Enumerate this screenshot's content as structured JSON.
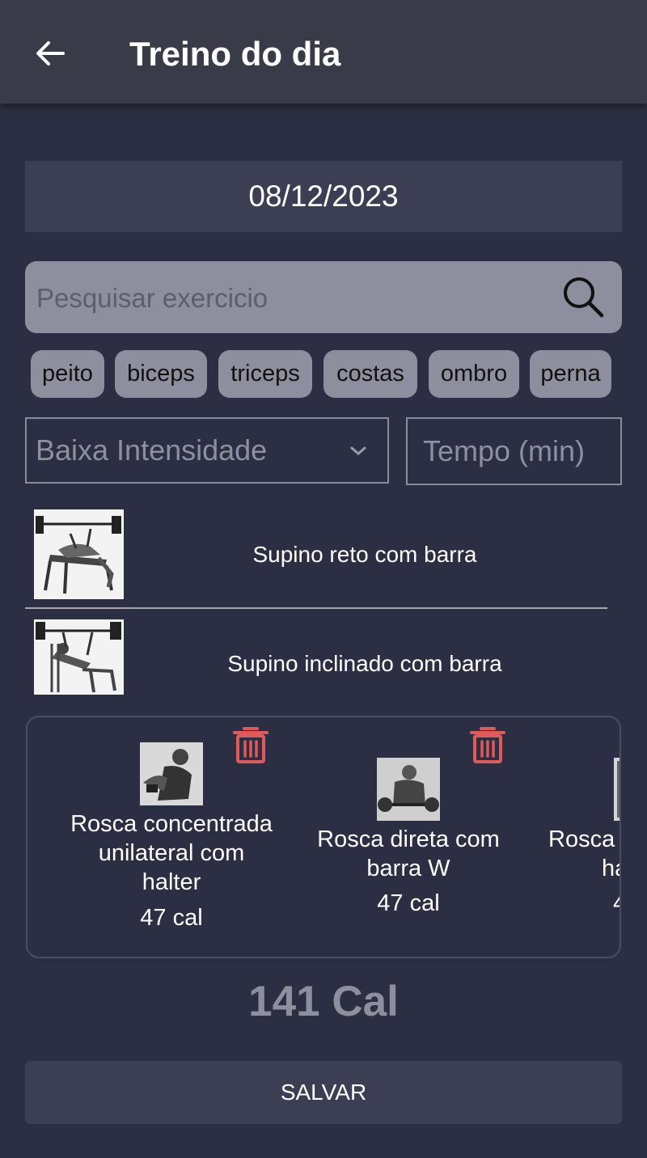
{
  "header": {
    "title": "Treino do dia",
    "back_icon": "arrow-left-icon"
  },
  "date": {
    "value": "08/12/2023"
  },
  "search": {
    "placeholder": "Pesquisar exercicio",
    "icon": "search-icon"
  },
  "chips": [
    "peito",
    "biceps",
    "triceps",
    "costas",
    "ombro",
    "perna"
  ],
  "intensity": {
    "selected": "Baixa Intensidade",
    "icon": "chevron-down-icon"
  },
  "time": {
    "placeholder": "Tempo (min)"
  },
  "exercises": [
    {
      "name": "Supino reto com barra"
    },
    {
      "name": "Supino inclinado com barra"
    }
  ],
  "selected": [
    {
      "name_lines": [
        "Rosca concentrada",
        "unilateral com",
        "halter"
      ],
      "calories": "47 cal"
    },
    {
      "name_lines": [
        "Rosca direta com",
        "barra W"
      ],
      "calories": "47 cal"
    },
    {
      "name_lines": [
        "Rosca",
        "ha"
      ],
      "calories": "4"
    }
  ],
  "total": "141 Cal",
  "save_label": "SALVAR",
  "colors": {
    "background": "#2c2e43",
    "appbar": "#3a3b48",
    "chip": "#8e8f9e",
    "trash": "#e05a5a"
  }
}
